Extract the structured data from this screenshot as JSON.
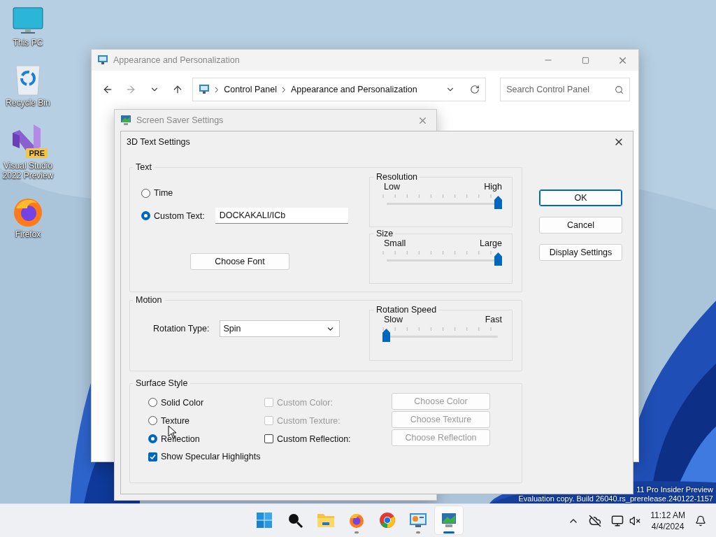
{
  "desktop_icons": [
    {
      "kind": "pc",
      "label": "This PC"
    },
    {
      "kind": "bin",
      "label": "Recycle Bin"
    },
    {
      "kind": "vs",
      "label": "Visual Studio 2022 Preview",
      "badge": "PRE"
    },
    {
      "kind": "firefox",
      "label": "Firefox"
    }
  ],
  "control_panel": {
    "title": "Appearance and Personalization",
    "address": [
      "Control Panel",
      "Appearance and Personalization"
    ],
    "search": {
      "placeholder": "Search Control Panel"
    }
  },
  "screen_saver": {
    "title": "Screen Saver Settings"
  },
  "dialog": {
    "title": "3D Text Settings",
    "text_group": {
      "title": "Text",
      "options": [
        {
          "label": "Time",
          "selected": false
        },
        {
          "label": "Custom Text:",
          "selected": true
        }
      ],
      "custom_text": "DOCKAKALI/ICb",
      "choose_font": "Choose Font"
    },
    "resolution": {
      "title": "Resolution",
      "low": "Low",
      "high": "High",
      "level": 1
    },
    "size": {
      "title": "Size",
      "low": "Small",
      "high": "Large",
      "level": 1
    },
    "motion": {
      "title": "Motion",
      "rotation_type_label": "Rotation Type:",
      "rotation_type": "Spin",
      "speed": {
        "title": "Rotation Speed",
        "low": "Slow",
        "high": "Fast",
        "level": 0
      }
    },
    "surface": {
      "title": "Surface Style",
      "rows": [
        {
          "radio": {
            "label": "Solid Color",
            "selected": false
          },
          "check": {
            "label": "Custom Color:",
            "checked": false,
            "disabled": true
          },
          "button": {
            "label": "Choose Color",
            "disabled": true
          }
        },
        {
          "radio": {
            "label": "Texture",
            "selected": false
          },
          "check": {
            "label": "Custom Texture:",
            "checked": false,
            "disabled": true
          },
          "button": {
            "label": "Choose Texture",
            "disabled": true
          }
        },
        {
          "radio": {
            "label": "Reflection",
            "selected": true
          },
          "check": {
            "label": "Custom Reflection:",
            "checked": false,
            "disabled": false
          },
          "button": {
            "label": "Choose Reflection",
            "disabled": true
          }
        }
      ],
      "specular": {
        "label": "Show Specular Highlights",
        "checked": true
      }
    },
    "buttons": [
      {
        "label": "OK",
        "default": true
      },
      {
        "label": "Cancel",
        "default": false
      },
      {
        "label": "Display Settings",
        "default": false
      }
    ]
  },
  "watermark": [
    "11 Pro Insider Preview",
    "Evaluation copy. Build 26040.rs_prerelease.240122-1157"
  ],
  "taskbar": {
    "apps": [
      {
        "kind": "start",
        "running": false,
        "active": false
      },
      {
        "kind": "search",
        "running": false,
        "active": false
      },
      {
        "kind": "folder",
        "running": false,
        "active": false
      },
      {
        "kind": "firefox",
        "running": true,
        "active": false
      },
      {
        "kind": "chrome",
        "running": false,
        "active": false
      },
      {
        "kind": "control",
        "running": true,
        "active": false
      },
      {
        "kind": "screensaver",
        "running": true,
        "active": true
      }
    ],
    "time": "11:12 AM",
    "date": "4/4/2024"
  }
}
